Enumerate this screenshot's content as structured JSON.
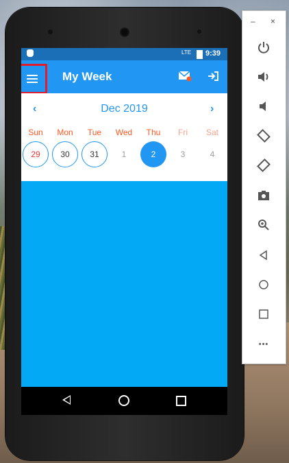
{
  "status_bar": {
    "time": "9:39",
    "signal": "LTE"
  },
  "app_bar": {
    "title": "My Week"
  },
  "calendar": {
    "prev": "‹",
    "next": "›",
    "month_label": "Dec 2019",
    "weekdays": [
      "Sun",
      "Mon",
      "Tue",
      "Wed",
      "Thu",
      "Fri",
      "Sat"
    ],
    "days": [
      "29",
      "30",
      "31",
      "1",
      "2",
      "3",
      "4"
    ]
  },
  "emulator": {
    "minimize": "–",
    "close": "×",
    "more": "•••"
  },
  "colors": {
    "primary": "#2196f3",
    "accent": "#ff5722",
    "background": "#03a9f4",
    "highlight_border": "#e21c2c"
  }
}
